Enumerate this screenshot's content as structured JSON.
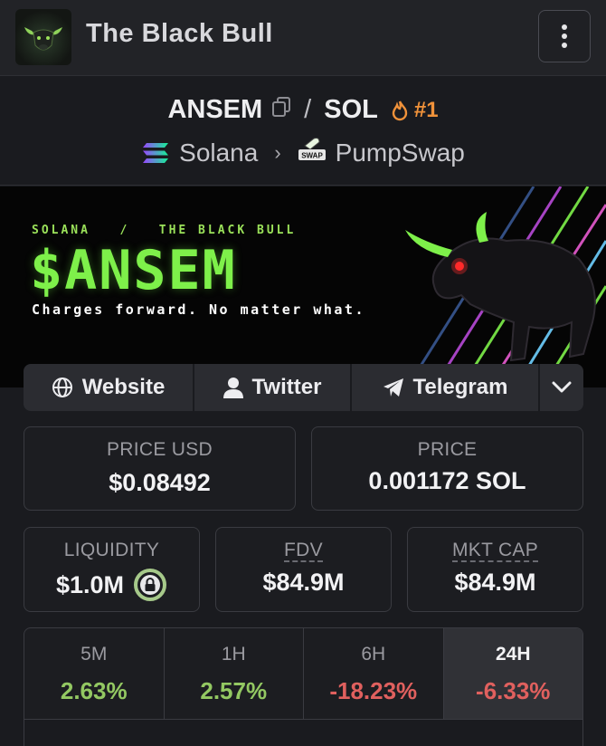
{
  "header": {
    "site_title": "The Black Bull",
    "logo_icon": "bull-logo-icon",
    "menu_icon": "vertical-dots-icon"
  },
  "pair": {
    "base": "ANSEM",
    "separator": "/",
    "quote": "SOL",
    "rank": "#1",
    "chain": "Solana",
    "dex": "PumpSwap",
    "dex_badge": "SWAP"
  },
  "banner": {
    "meta": "SOLANA   /   THE BLACK BULL",
    "title": "$ANSEM",
    "tagline": "Charges forward. No matter what."
  },
  "links": {
    "website": "Website",
    "twitter": "Twitter",
    "telegram": "Telegram"
  },
  "stats": {
    "price_usd_label": "PRICE USD",
    "price_usd": "$0.08492",
    "price_label": "PRICE",
    "price_sol": "0.001172 SOL",
    "liquidity_label": "LIQUIDITY",
    "liquidity": "$1.0M",
    "fdv_label": "FDV",
    "fdv": "$84.9M",
    "mktcap_label": "MKT CAP",
    "mktcap": "$84.9M"
  },
  "timeframes": [
    {
      "label": "5M",
      "change": "2.63%"
    },
    {
      "label": "1H",
      "change": "2.57%"
    },
    {
      "label": "6H",
      "change": "-18.23%"
    },
    {
      "label": "24H",
      "change": "-6.33%"
    }
  ],
  "colors": {
    "accent_green": "#7ef04a",
    "positive": "#93c862",
    "negative": "#e0605e",
    "rank_orange": "#f0923a"
  }
}
